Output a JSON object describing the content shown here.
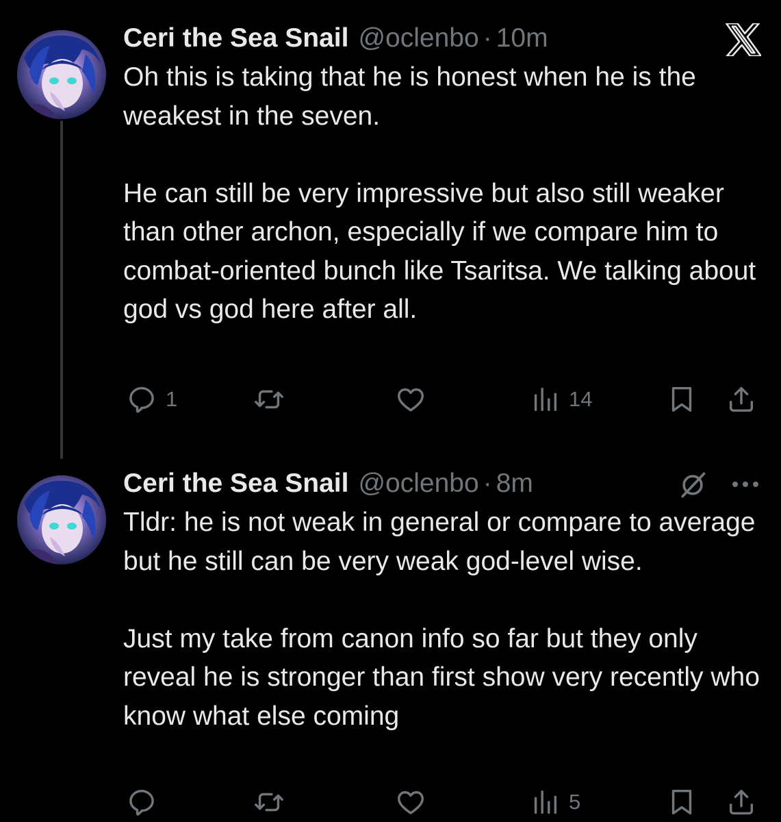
{
  "tweets": [
    {
      "display_name": "Ceri the Sea Snail",
      "handle": "@oclenbo",
      "separator": "·",
      "time": "10m",
      "paragraphs": [
        "Oh this is taking that he is honest when he is the weakest in the seven.",
        "He can still be very impressive but also still weaker than other archon, especially if we compare him to combat-oriented bunch like Tsaritsa. We talking about god vs god here after all."
      ],
      "stats": {
        "replies": "1",
        "views": "14"
      },
      "corner_icon": "x-logo-icon"
    },
    {
      "display_name": "Ceri the Sea Snail",
      "handle": "@oclenbo",
      "separator": "·",
      "time": "8m",
      "paragraphs": [
        "Tldr: he is not weak in general or compare to average but he still can be very weak god-level wise.",
        "Just my take from canon info so far but they only reveal he is stronger than first show very recently who know what else coming"
      ],
      "stats": {
        "views": "5"
      },
      "corner_icons": [
        "grok-icon",
        "more-icon"
      ]
    }
  ],
  "icons": {
    "reply": "reply-icon",
    "retweet": "retweet-icon",
    "like": "like-icon",
    "views": "views-icon",
    "bookmark": "bookmark-icon",
    "share": "share-icon"
  },
  "colors": {
    "background": "#000000",
    "text_primary": "#e7e9ea",
    "text_secondary": "#71767b",
    "thread_line": "#333639"
  }
}
